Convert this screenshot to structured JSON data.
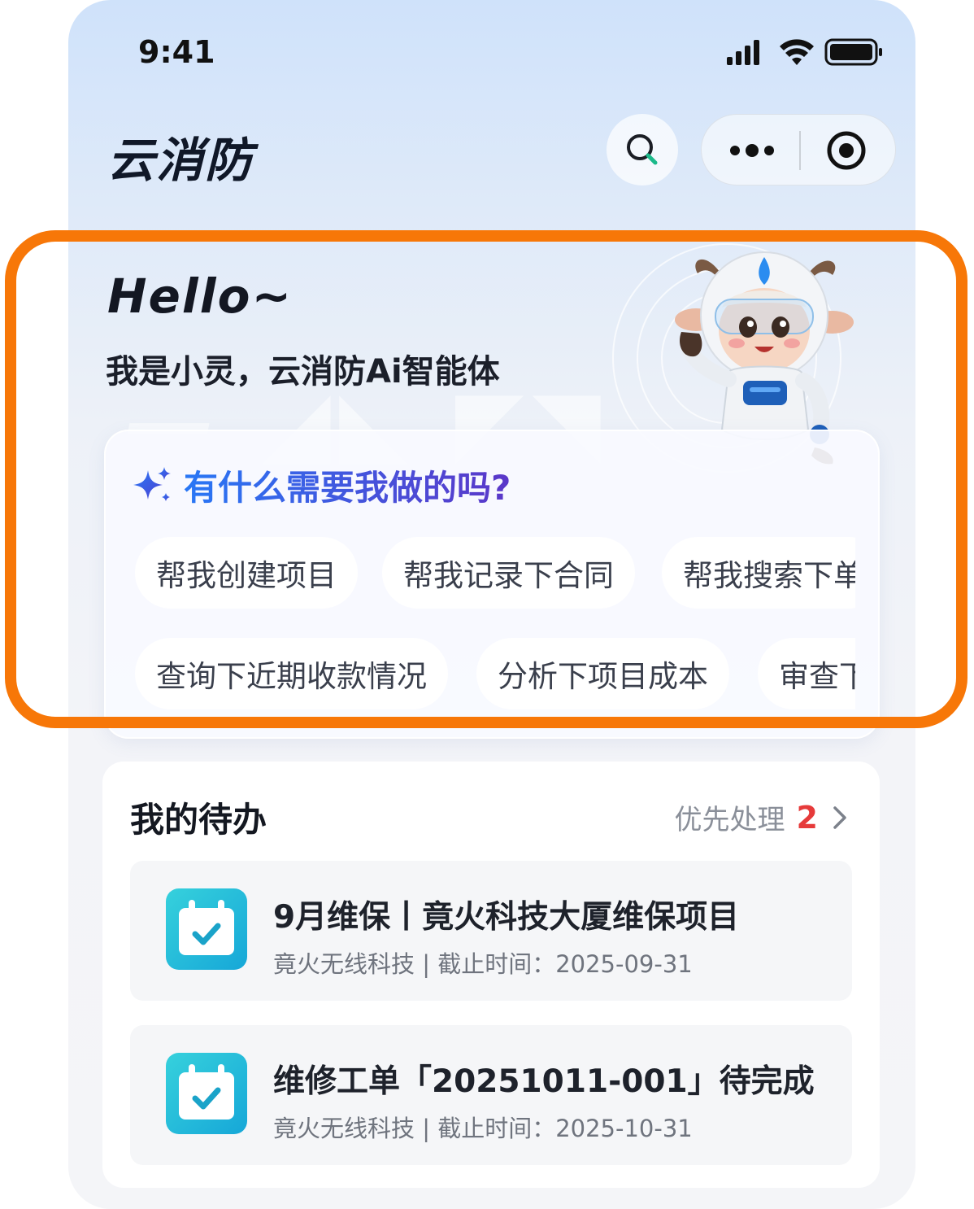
{
  "status_bar": {
    "time": "9:41"
  },
  "header": {
    "app_title": "云消防"
  },
  "hero": {
    "greeting": "Hello~",
    "intro": "我是小灵，云消防Ai智能体",
    "question": "有什么需要我做的吗?",
    "suggestions_row1": [
      "帮我创建项目",
      "帮我记录下合同",
      "帮我搜索下单"
    ],
    "suggestions_row2": [
      "查询下近期收款情况",
      "分析下项目成本",
      "审查下"
    ]
  },
  "todo": {
    "title": "我的待办",
    "priority_label": "优先处理",
    "priority_count": "2",
    "items": [
      {
        "title": "9月维保丨竟火科技大厦维保项目",
        "subtitle": "竟火无线科技 | 截止时间：2025-09-31"
      },
      {
        "title": "维修工单「20251011-001」待完成",
        "subtitle": "竟火无线科技 | 截止时间：2025-10-31"
      }
    ]
  },
  "colors": {
    "accent": "#2a6bf0",
    "highlight": "#f77708",
    "badge": "#e63a3a"
  },
  "icons": [
    "signal-icon",
    "wifi-icon",
    "battery-icon",
    "search-icon",
    "more-icon",
    "target-icon",
    "sparkle-icon",
    "chevron-right-icon",
    "calendar-check-icon"
  ]
}
